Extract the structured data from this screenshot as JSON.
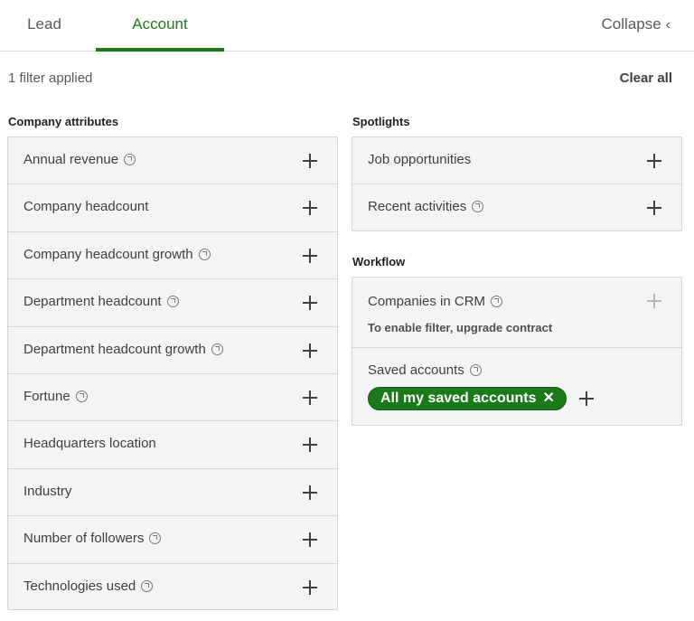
{
  "tabs": [
    {
      "label": "Lead",
      "active": false
    },
    {
      "label": "Account",
      "active": true
    }
  ],
  "collapse_label": "Collapse",
  "filter_summary": "1 filter applied",
  "clear_all_label": "Clear all",
  "company_attributes": {
    "title": "Company attributes",
    "items": [
      {
        "label": "Annual revenue",
        "info_icon": true
      },
      {
        "label": "Company headcount",
        "info_icon": false
      },
      {
        "label": "Company headcount growth",
        "info_icon": true
      },
      {
        "label": "Department headcount",
        "info_icon": true
      },
      {
        "label": "Department headcount growth",
        "info_icon": true
      },
      {
        "label": "Fortune",
        "info_icon": true
      },
      {
        "label": "Headquarters location",
        "info_icon": false
      },
      {
        "label": "Industry",
        "info_icon": false
      },
      {
        "label": "Number of followers",
        "info_icon": true
      },
      {
        "label": "Technologies used",
        "info_icon": true
      }
    ]
  },
  "spotlights": {
    "title": "Spotlights",
    "items": [
      {
        "label": "Job opportunities",
        "info_icon": false
      },
      {
        "label": "Recent activities",
        "info_icon": true
      }
    ]
  },
  "workflow": {
    "title": "Workflow",
    "crm": {
      "label": "Companies in CRM",
      "note": "To enable filter, upgrade contract",
      "disabled": true
    },
    "saved_accounts": {
      "label": "Saved accounts",
      "selected_pill": "All my saved accounts",
      "remove_glyph": "✕"
    }
  },
  "colors": {
    "accent_green": "#1a7a1a",
    "panel_bg": "#f3f4f6",
    "border": "#d6d6d6"
  },
  "icons": {
    "info": "external-link-circle-icon",
    "add": "plus-icon",
    "collapse": "chevron-left-icon"
  }
}
